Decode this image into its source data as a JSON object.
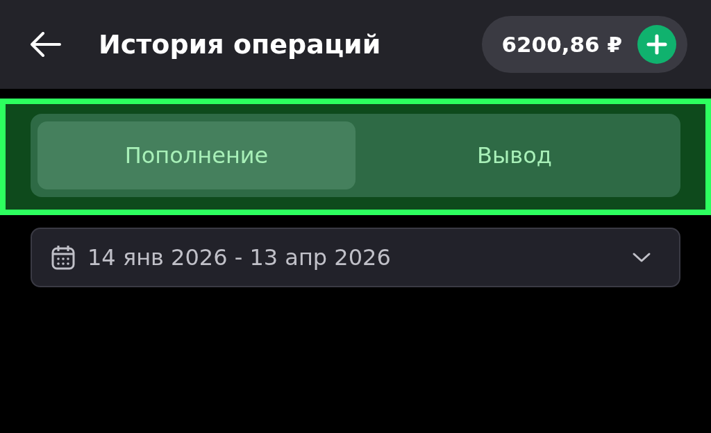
{
  "header": {
    "title": "История операций",
    "balance": "6200,86 ₽"
  },
  "tabs_section": {
    "highlighted": true,
    "tabs": [
      {
        "label": "Пополнение",
        "selected": true
      },
      {
        "label": "Вывод",
        "selected": false
      }
    ]
  },
  "date_filter": {
    "value": "14 янв 2026 - 13 апр 2026"
  }
}
